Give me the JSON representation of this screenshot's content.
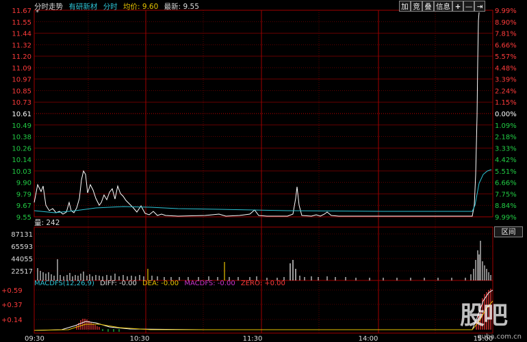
{
  "header": {
    "title": "分时走势",
    "stock_name": "有研新材",
    "mode": "分时",
    "avg_label": "均价: 9.60",
    "latest_label": "最新: 9.55",
    "star": "*"
  },
  "toolbar": {
    "add": "加",
    "compete": "竞",
    "overlay": "叠",
    "info": "信息",
    "plus": "+",
    "minus": "—",
    "end": "⇥"
  },
  "price_axis": {
    "left": [
      "11.67",
      "11.55",
      "11.44",
      "11.32",
      "11.20",
      "11.09",
      "10.97",
      "10.85",
      "10.73",
      "10.61",
      "10.49",
      "10.38",
      "10.26",
      "10.14",
      "10.03",
      "9.90",
      "9.79",
      "9.67",
      "9.55"
    ],
    "right": [
      "9.99%",
      "8.90%",
      "7.81%",
      "6.66%",
      "5.57%",
      "4.48%",
      "3.39%",
      "2.24%",
      "1.15%",
      "0.00%",
      "1.09%",
      "2.18%",
      "3.33%",
      "4.42%",
      "5.51%",
      "6.66%",
      "7.75%",
      "8.84%",
      "9.99%"
    ]
  },
  "volume": {
    "label": "量: 242",
    "axis": [
      "87131",
      "65593",
      "44055",
      "22517"
    ],
    "range_button": "区间"
  },
  "macd": {
    "name": "MACDFS(12,26,9)",
    "diff": "DIFF: -0.00",
    "dea": "DEA: -0.00",
    "macdfs": "MACDFS: -0.00",
    "zero": "ZERO: +0.00",
    "axis": [
      "+0.59",
      "+0.37",
      "+0.14"
    ]
  },
  "time_axis": [
    "09:30",
    "10:30",
    "11:30",
    "14:00",
    "15:00"
  ],
  "watermark": {
    "logo": "股吧",
    "url": "guba.com.cn"
  },
  "colors": {
    "up": "#ff3b3b",
    "down": "#22cc44",
    "flat": "#ffffff",
    "avg_line": "#2ec4d6",
    "grid_red": "#a00000",
    "stock_name": "#2ec4d6"
  }
}
